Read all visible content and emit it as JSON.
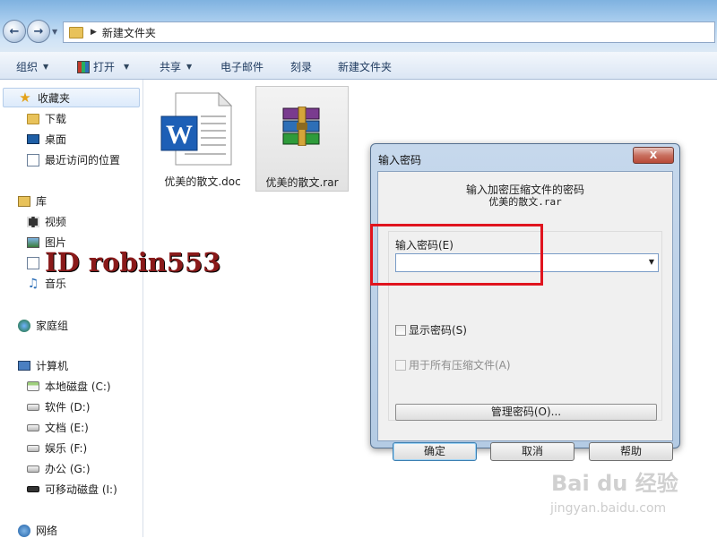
{
  "window": {
    "path": "新建文件夹"
  },
  "toolbar": {
    "organize": "组织",
    "open": "打开",
    "share": "共享",
    "email": "电子邮件",
    "burn": "刻录",
    "new_folder": "新建文件夹"
  },
  "sidebar": {
    "favorites": "收藏夹",
    "downloads": "下载",
    "desktop": "桌面",
    "recent": "最近访问的位置",
    "libraries": "库",
    "videos": "视频",
    "pictures": "图片",
    "documents": "文档",
    "music": "音乐",
    "homegroup": "家庭组",
    "computer": "计算机",
    "drives": [
      {
        "label": "本地磁盘 (C:)"
      },
      {
        "label": "软件 (D:)"
      },
      {
        "label": "文档 (E:)"
      },
      {
        "label": "娱乐 (F:)"
      },
      {
        "label": "办公 (G:)"
      },
      {
        "label": "可移动磁盘 (I:)"
      }
    ],
    "network": "网络"
  },
  "files": [
    {
      "name": "优美的散文.doc",
      "icon": "word-doc-icon"
    },
    {
      "name": "优美的散文.rar",
      "icon": "rar-archive-icon"
    }
  ],
  "watermark": {
    "id_text": "ID robin553",
    "baidu": "Bai du 经验",
    "baidu_url": "jingyan.baidu.com"
  },
  "dialog": {
    "title": "输入密码",
    "close": "X",
    "message_line1": "输入加密压缩文件的密码",
    "message_line2": "优美的散文.rar",
    "password_label": "输入密码(E)",
    "password_value": "",
    "show_password": "显示密码(S)",
    "use_for_all": "用于所有压缩文件(A)",
    "manage": "管理密码(O)...",
    "ok": "确定",
    "cancel": "取消",
    "help": "帮助"
  },
  "colors": {
    "highlight": "#e0141e",
    "address_bar": "#a9cdee",
    "dialog_frame": "#b4cbe4"
  }
}
